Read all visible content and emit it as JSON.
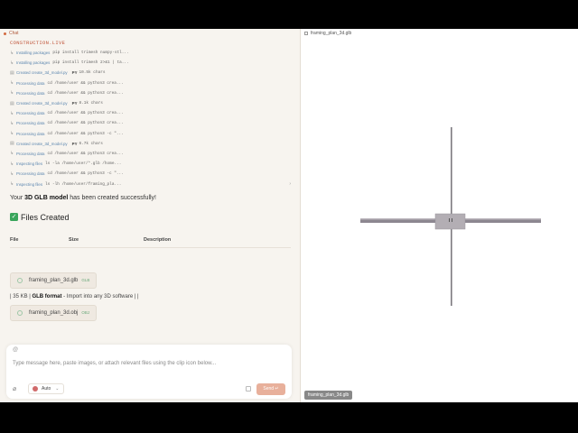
{
  "chat": {
    "header_title": "Chat",
    "project_name": "CONSTRUCTION.LIVE",
    "log": [
      {
        "type": "cmd",
        "label": "Installing packages",
        "text": "pip install trimesh numpy-stl..."
      },
      {
        "type": "cmd",
        "label": "Installing packages",
        "text": "pip install trimesh 2>&1 | ta..."
      },
      {
        "type": "file",
        "label": "Created create_3d_model.py",
        "ext": "PY",
        "size": "10.5k chars"
      },
      {
        "type": "cmd",
        "label": "Processing data",
        "text": "cd /home/user && python3 crea..."
      },
      {
        "type": "cmd",
        "label": "Processing data",
        "text": "cd /home/user && python3 crea..."
      },
      {
        "type": "file",
        "label": "Created create_3d_model.py",
        "ext": "PY",
        "size": "8.1k chars"
      },
      {
        "type": "cmd",
        "label": "Processing data",
        "text": "cd /home/user && python3 crea..."
      },
      {
        "type": "cmd",
        "label": "Processing data",
        "text": "cd /home/user && python3 crea..."
      },
      {
        "type": "cmd",
        "label": "Processing data",
        "text": "cd /home/user && python3 -c \"..."
      },
      {
        "type": "file",
        "label": "Created create_3d_model.py",
        "ext": "PY",
        "size": "6.7k chars"
      },
      {
        "type": "cmd",
        "label": "Processing data",
        "text": "cd /home/user && python3 crea..."
      },
      {
        "type": "cmd",
        "label": "Inspecting files",
        "text": "ls -la /home/user/*.glb /home..."
      },
      {
        "type": "cmd",
        "label": "Processing data",
        "text": "cd /home/user && python3 -c \"..."
      },
      {
        "type": "cmd",
        "label": "Inspecting files",
        "text": "ls -lh /home/user/framing_pla..."
      }
    ],
    "message_pre": "Your ",
    "message_bold": "3D GLB model",
    "message_post": " has been created successfully!",
    "files_heading": "Files Created",
    "table_headers": [
      "File",
      "Size",
      "Description"
    ],
    "file1_name": "framing_plan_3d.glb",
    "file1_ext": "GLB",
    "glb_line_pre": "| 35 KB | ",
    "glb_line_bold": "GLB format",
    "glb_line_post": " - Import into any 3D software | |",
    "file2_name": "framing_plan_3d.obj",
    "file2_ext": "OBJ"
  },
  "input": {
    "at_symbol": "@",
    "placeholder": "Type message here, paste images, or attach relevant files using the clip icon below...",
    "model_label": "Auto",
    "send_label": "Send ↵"
  },
  "viewer": {
    "header_title": "framing_plan_3d.glb",
    "bottom_label": "framing_plan_3d.glb"
  },
  "colors": {
    "accent": "#d2693f",
    "beam": "#8c8790",
    "block": "#b3aeb4",
    "post": "#7d7a80"
  },
  "icons": [
    "chat-dot-icon",
    "step-icon",
    "file-icon",
    "check-icon",
    "clip-icon",
    "model-icon",
    "upload-icon",
    "chevron-right-icon"
  ]
}
